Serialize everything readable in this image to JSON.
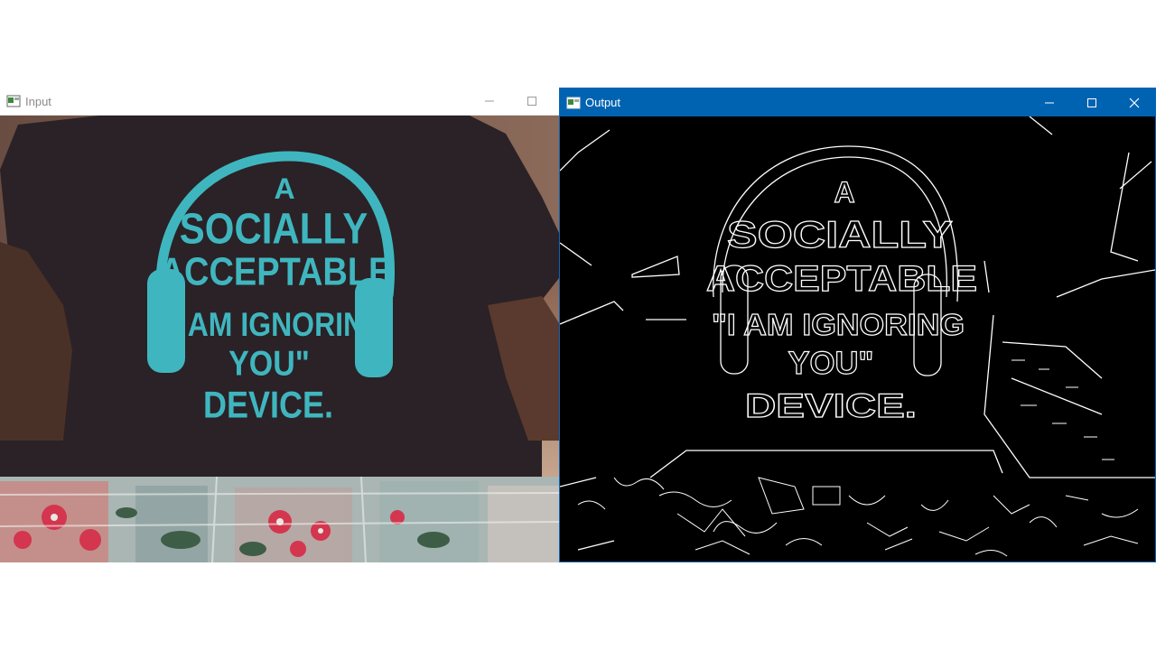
{
  "windows": {
    "input": {
      "title": "Input",
      "icon": "opencv-window-icon",
      "state": "inactive"
    },
    "output": {
      "title": "Output",
      "icon": "opencv-window-icon",
      "state": "active",
      "accent_color": "#0063b1"
    }
  },
  "shirt_text": {
    "line1": "A",
    "line2": "SOCIALLY",
    "line3": "ACCEPTABLE",
    "line4": "\"I AM IGNORING",
    "line5": "YOU\"",
    "line6": "DEVICE."
  },
  "colors": {
    "shirt": "#2a2226",
    "print": "#3fb6bf",
    "edges": "#ffffff",
    "edge_background": "#000000"
  }
}
